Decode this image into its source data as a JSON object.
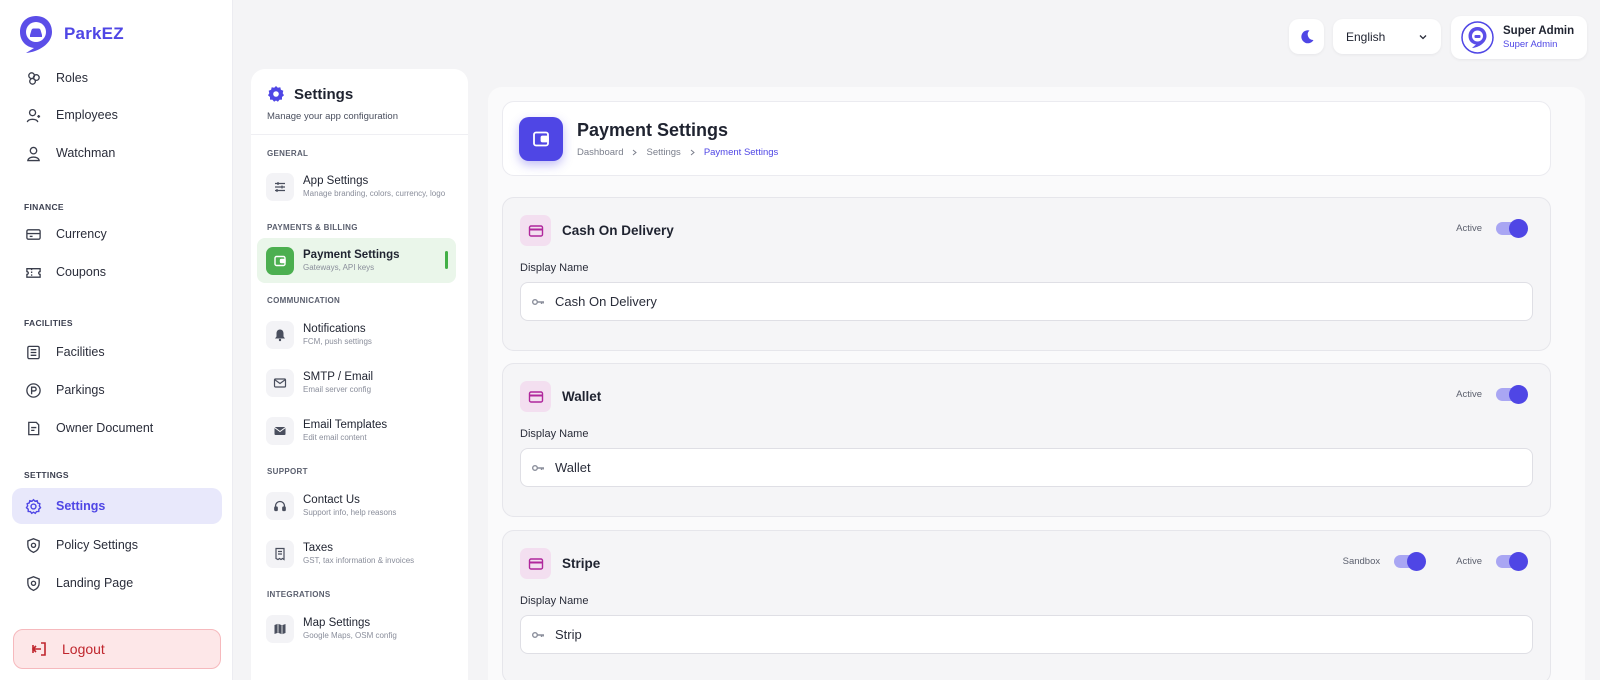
{
  "brand": {
    "name": "ParkEZ"
  },
  "sidebar": {
    "items": [
      {
        "label": "Roles",
        "icon": "roles-icon"
      },
      {
        "label": "Employees",
        "icon": "employees-icon"
      },
      {
        "label": "Watchman",
        "icon": "user-icon"
      },
      {
        "label": "Currency",
        "icon": "currency-icon"
      },
      {
        "label": "Coupons",
        "icon": "coupon-icon"
      },
      {
        "label": "Facilities",
        "icon": "facilities-icon"
      },
      {
        "label": "Parkings",
        "icon": "parking-icon"
      },
      {
        "label": "Owner Document",
        "icon": "document-icon"
      },
      {
        "label": "Settings",
        "icon": "gear-icon",
        "active": true
      },
      {
        "label": "Policy Settings",
        "icon": "shield-icon"
      },
      {
        "label": "Landing Page",
        "icon": "shield-icon"
      }
    ],
    "sections": [
      "FINANCE",
      "FACILITIES",
      "SETTINGS"
    ],
    "logout_label": "Logout"
  },
  "topbar": {
    "language": "English",
    "user_name": "Super Admin",
    "user_role": "Super Admin"
  },
  "settings_menu": {
    "title": "Settings",
    "subtitle": "Manage your app configuration",
    "sections": [
      "GENERAL",
      "PAYMENTS & BILLING",
      "COMMUNICATION",
      "SUPPORT",
      "INTEGRATIONS"
    ],
    "items": [
      {
        "label": "App Settings",
        "desc": "Manage branding, colors, currency, logo"
      },
      {
        "label": "Payment Settings",
        "desc": "Gateways, API keys",
        "active": true
      },
      {
        "label": "Notifications",
        "desc": "FCM, push settings"
      },
      {
        "label": "SMTP / Email",
        "desc": "Email server config"
      },
      {
        "label": "Email Templates",
        "desc": "Edit email content"
      },
      {
        "label": "Contact Us",
        "desc": "Support info, help reasons"
      },
      {
        "label": "Taxes",
        "desc": "GST, tax information & invoices"
      },
      {
        "label": "Map Settings",
        "desc": "Google Maps, OSM config"
      }
    ]
  },
  "page": {
    "title": "Payment Settings",
    "breadcrumb": [
      "Dashboard",
      "Settings",
      "Payment Settings"
    ]
  },
  "gateways": [
    {
      "title": "Cash On Delivery",
      "field_label": "Display Name",
      "value": "Cash On Delivery",
      "active_label": "Active",
      "active": true
    },
    {
      "title": "Wallet",
      "field_label": "Display Name",
      "value": "Wallet",
      "active_label": "Active",
      "active": true
    },
    {
      "title": "Stripe",
      "field_label": "Display Name",
      "value": "Strip",
      "sandbox_label": "Sandbox",
      "sandbox": true,
      "active_label": "Active",
      "active": true
    }
  ],
  "colors": {
    "accent": "#4f46e5",
    "success": "#4caf50",
    "danger": "#c0262d"
  }
}
